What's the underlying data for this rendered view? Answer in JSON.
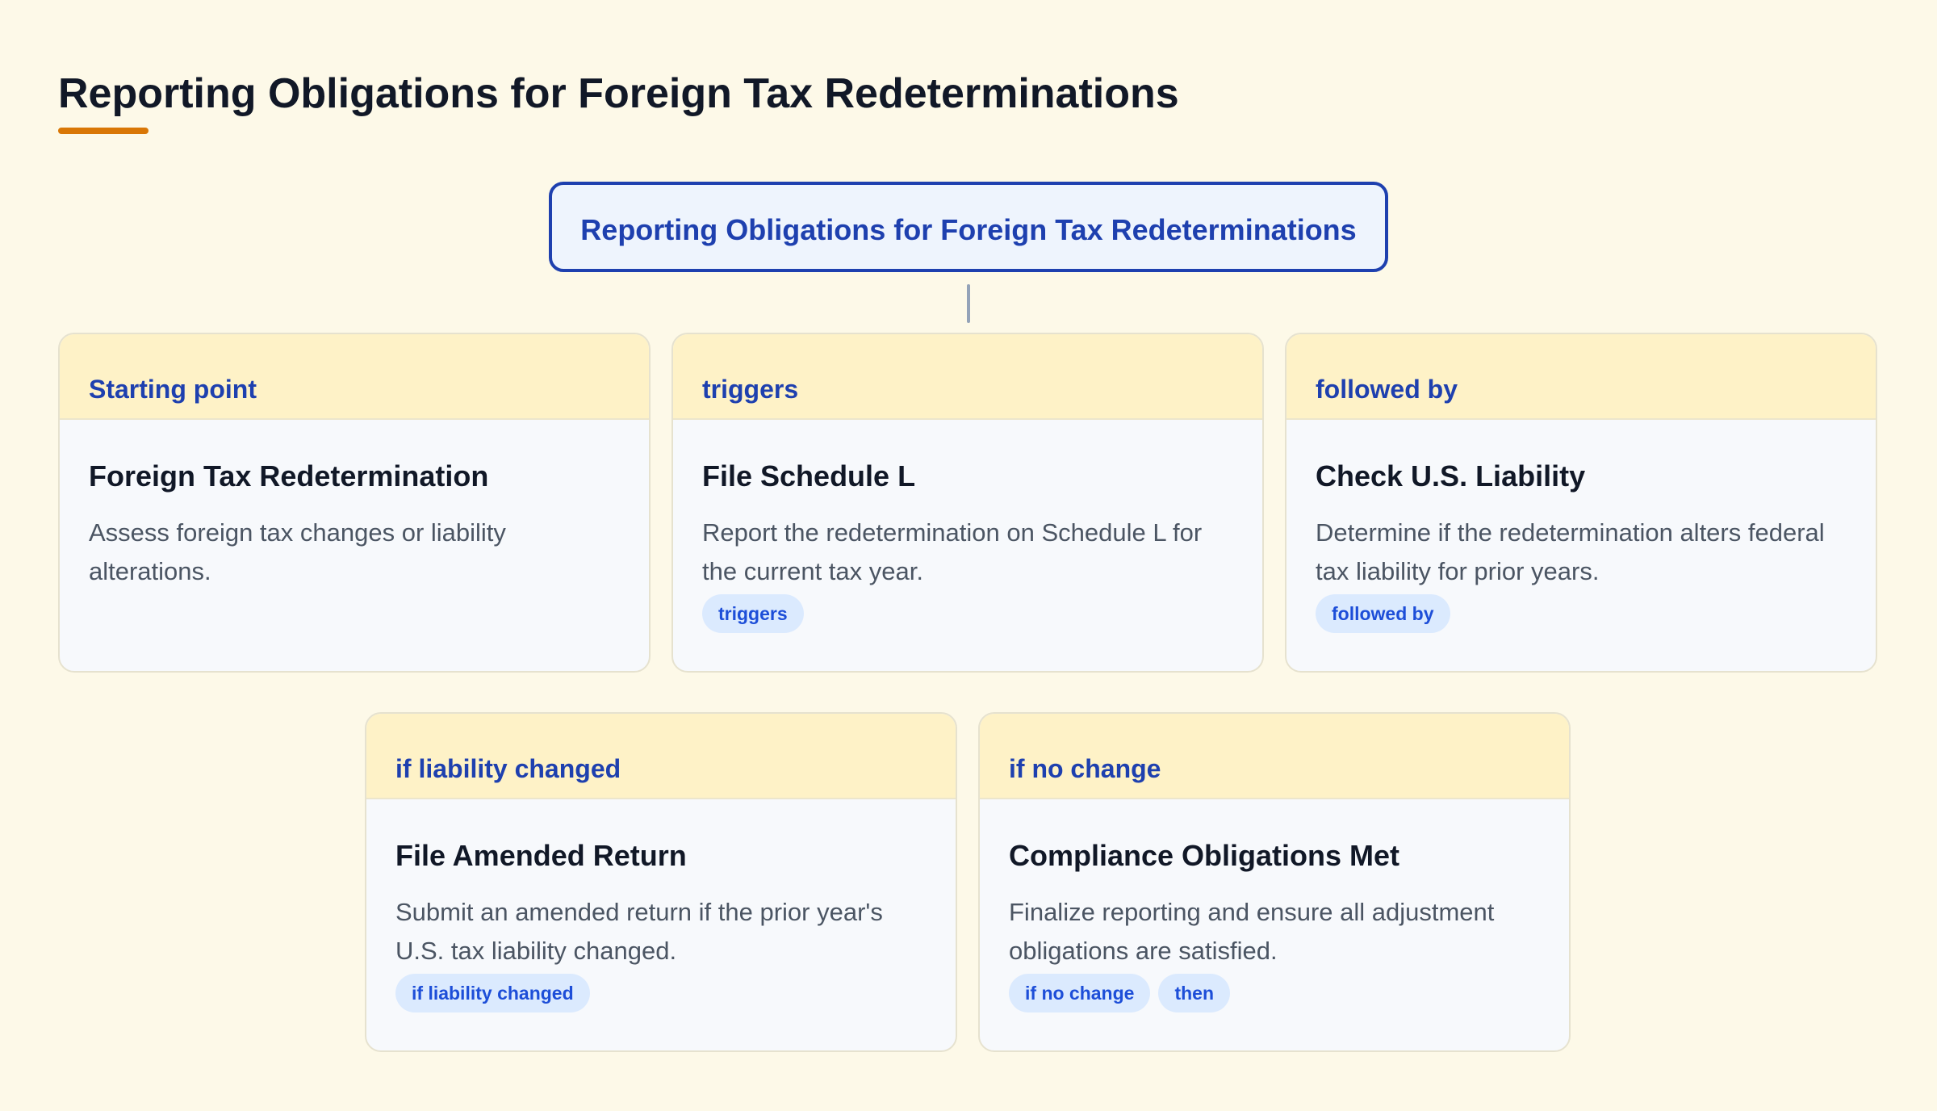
{
  "page": {
    "title": "Reporting Obligations for Foreign Tax Redeterminations"
  },
  "root": {
    "label": "Reporting Obligations for Foreign Tax Redeterminations"
  },
  "cards": [
    {
      "header": "Starting point",
      "title": "Foreign Tax Redetermination",
      "description": "Assess foreign tax changes or liability alterations.",
      "tags": []
    },
    {
      "header": "triggers",
      "title": "File Schedule L",
      "description": "Report the redetermination on Schedule L for the current tax year.",
      "tags": [
        "triggers"
      ]
    },
    {
      "header": "followed by",
      "title": "Check U.S. Liability",
      "description": "Determine if the redetermination alters federal tax liability for prior years.",
      "tags": [
        "followed by"
      ]
    },
    {
      "header": "if liability changed",
      "title": "File Amended Return",
      "description": "Submit an amended return if the prior year's U.S. tax liability changed.",
      "tags": [
        "if liability changed"
      ]
    },
    {
      "header": "if no change",
      "title": "Compliance Obligations Met",
      "description": "Finalize reporting and ensure all adjustment obligations are satisfied.",
      "tags": [
        "if no change",
        "then"
      ]
    }
  ],
  "colors": {
    "background": "#fdf9e8",
    "accent": "#d97706",
    "primary": "#1e40af",
    "card_header": "#fef2c7",
    "tag_background": "#dbeafe"
  }
}
